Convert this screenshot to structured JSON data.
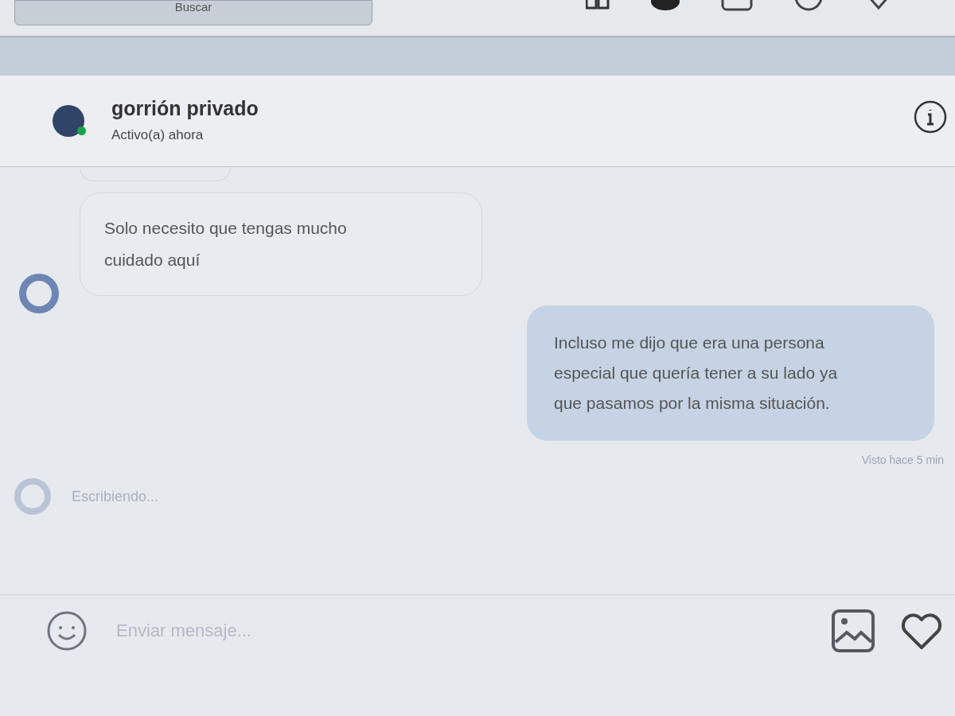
{
  "top_bar": {
    "search": {
      "placeholder": "Buscar"
    }
  },
  "chat_header": {
    "name": "gorrión privado",
    "status": "Activo(a) ahora",
    "online": true
  },
  "messages": [
    {
      "kind": "received",
      "text": "Solo necesito que tengas mucho cuidado aquí"
    },
    {
      "kind": "sent",
      "text": "Incluso me dijo que era una persona especial que quería tener a su lado ya que pasamos por la misma situación."
    }
  ],
  "seen": "Visto hace 5 min",
  "typing": "Escribiendo...",
  "composer": {
    "placeholder": "Enviar mensaje..."
  }
}
